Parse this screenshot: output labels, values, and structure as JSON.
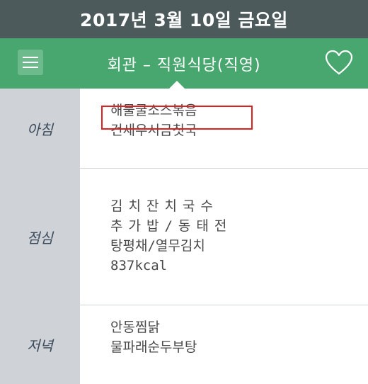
{
  "header": {
    "date": "2017년 3월 10일 금요일"
  },
  "nav": {
    "title": "회관  –  직원식당(직영)",
    "menu_icon": "hamburger-menu-icon",
    "favorite_icon": "heart-icon"
  },
  "meals": {
    "breakfast": {
      "label": "아침",
      "items": [
        "해물굴소스볶음",
        "건새우시금칫국"
      ]
    },
    "lunch": {
      "label": "점심",
      "items": [
        "김치잔치국수",
        "추가밥/동태전",
        "탕평채/열무김치",
        "837kcal"
      ]
    },
    "dinner": {
      "label": "저녁",
      "items": [
        "안동찜닭",
        "물파래순두부탕"
      ]
    }
  },
  "colors": {
    "date_bar": "#4d5a5c",
    "nav_bar": "#48a76f",
    "label_column": "#cfd3d8",
    "highlight_box": "#e02020"
  }
}
